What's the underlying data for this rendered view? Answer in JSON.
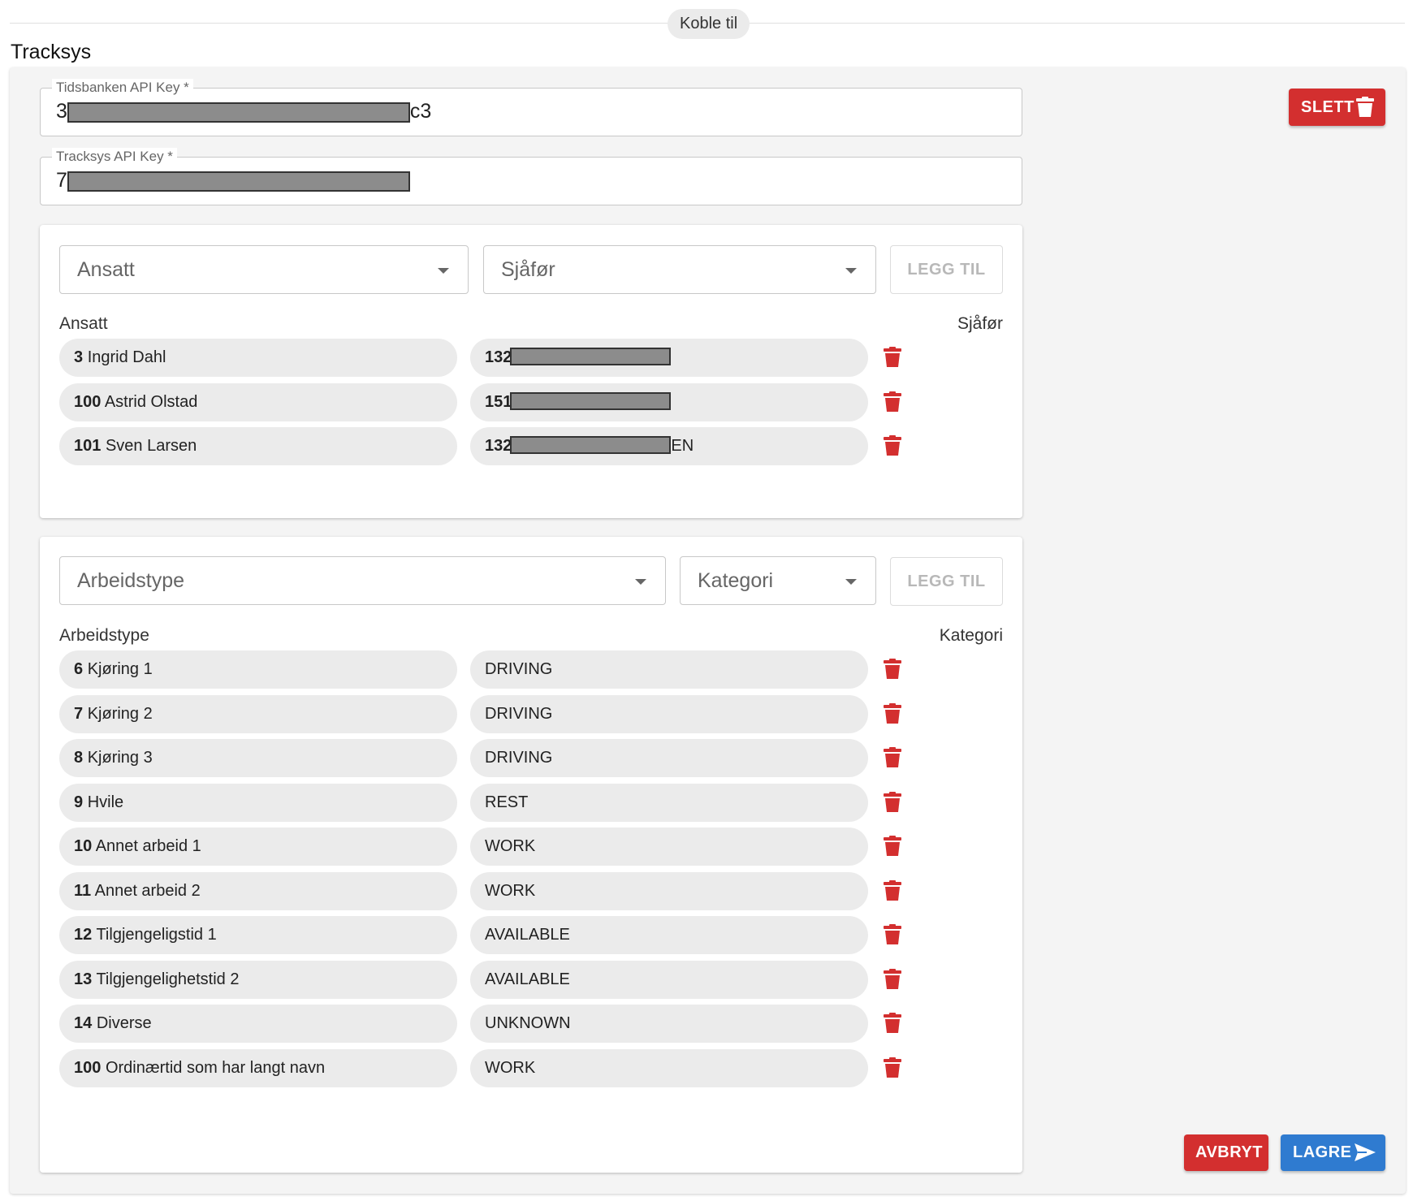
{
  "header": {
    "chip_label": "Koble til",
    "title": "Tracksys"
  },
  "fields": {
    "tidsbanken": {
      "label": "Tidsbanken API Key *",
      "value_start": "3",
      "value_end": "c3"
    },
    "tracksys": {
      "label": "Tracksys API Key *",
      "value_start": "7"
    }
  },
  "buttons": {
    "delete": "SLETT",
    "cancel": "AVBRYT",
    "save": "LAGRE"
  },
  "employees": {
    "select_employee": "Ansatt",
    "select_driver": "Sjåfør",
    "add_label": "LEGG TIL",
    "col_employee": "Ansatt",
    "col_driver": "Sjåfør",
    "rows": [
      {
        "id": "3",
        "name": "Ingrid Dahl",
        "driver_start": "132",
        "driver_end": ""
      },
      {
        "id": "100",
        "name": "Astrid Olstad",
        "driver_start": "151",
        "driver_end": ""
      },
      {
        "id": "101",
        "name": "Sven Larsen",
        "driver_start": "132",
        "driver_end": "EN"
      }
    ]
  },
  "worktypes": {
    "select_worktype": "Arbeidstype",
    "select_category": "Kategori",
    "add_label": "LEGG TIL",
    "col_worktype": "Arbeidstype",
    "col_category": "Kategori",
    "rows": [
      {
        "id": "6",
        "name": "Kjøring 1",
        "category": "DRIVING"
      },
      {
        "id": "7",
        "name": "Kjøring 2",
        "category": "DRIVING"
      },
      {
        "id": "8",
        "name": "Kjøring 3",
        "category": "DRIVING"
      },
      {
        "id": "9",
        "name": "Hvile",
        "category": "REST"
      },
      {
        "id": "10",
        "name": "Annet arbeid 1",
        "category": "WORK"
      },
      {
        "id": "11",
        "name": "Annet arbeid 2",
        "category": "WORK"
      },
      {
        "id": "12",
        "name": "Tilgjengeligstid 1",
        "category": "AVAILABLE"
      },
      {
        "id": "13",
        "name": "Tilgjengelighetstid 2",
        "category": "AVAILABLE"
      },
      {
        "id": "14",
        "name": "Diverse",
        "category": "UNKNOWN"
      },
      {
        "id": "100",
        "name": "Ordinærtid som har langt navn",
        "category": "WORK"
      }
    ]
  },
  "colors": {
    "danger": "#d32f2f",
    "primary": "#2f7bd0",
    "pill_bg": "#ebebeb"
  },
  "icons": {
    "trash": "trash-icon",
    "send": "send-icon",
    "dropdown": "chevron-down-icon"
  }
}
